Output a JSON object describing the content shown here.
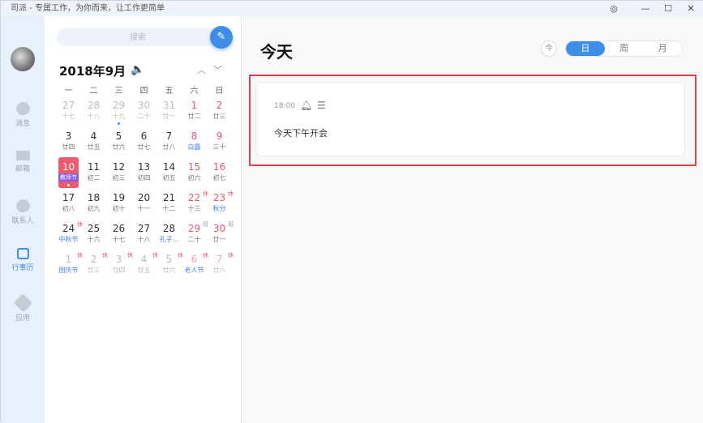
{
  "window": {
    "title": "司派 - 专属工作，为你而来，让工作更简单",
    "settings_icon": "◎",
    "min": "—",
    "max": "☐",
    "close": "✕"
  },
  "sidebar": {
    "items": [
      {
        "label": "消息"
      },
      {
        "label": "邮箱"
      },
      {
        "label": "联系人"
      },
      {
        "label": "行事历",
        "active": true
      },
      {
        "label": "应用"
      }
    ]
  },
  "calendar": {
    "search_placeholder": "搜索",
    "edit_icon": "✎",
    "month": "2018年9月",
    "speaker_icon": "🔈",
    "prev": "︿",
    "next": "﹀",
    "weekdays": [
      "一",
      "二",
      "三",
      "四",
      "五",
      "六",
      "日"
    ],
    "cells": [
      {
        "n": "27",
        "l": "十七",
        "o": 1
      },
      {
        "n": "28",
        "l": "十八",
        "o": 1
      },
      {
        "n": "29",
        "l": "十九",
        "o": 1,
        "dot": 1
      },
      {
        "n": "30",
        "l": "二十",
        "o": 1
      },
      {
        "n": "31",
        "l": "廿一",
        "o": 1
      },
      {
        "n": "1",
        "l": "廿二",
        "r": 1
      },
      {
        "n": "2",
        "l": "廿三",
        "r": 1
      },
      {
        "n": "3",
        "l": "廿四"
      },
      {
        "n": "4",
        "l": "廿五"
      },
      {
        "n": "5",
        "l": "廿六"
      },
      {
        "n": "6",
        "l": "廿七"
      },
      {
        "n": "7",
        "l": "廿八"
      },
      {
        "n": "8",
        "l": "白露",
        "r": 1,
        "f": 1
      },
      {
        "n": "9",
        "l": "三十",
        "r": 1
      },
      {
        "n": "10",
        "l": "教师节",
        "today": 1,
        "dot": 1
      },
      {
        "n": "11",
        "l": "初二"
      },
      {
        "n": "12",
        "l": "初三"
      },
      {
        "n": "13",
        "l": "初四"
      },
      {
        "n": "14",
        "l": "初五"
      },
      {
        "n": "15",
        "l": "初六",
        "r": 1
      },
      {
        "n": "16",
        "l": "初七",
        "r": 1
      },
      {
        "n": "17",
        "l": "初八"
      },
      {
        "n": "18",
        "l": "初九"
      },
      {
        "n": "19",
        "l": "初十"
      },
      {
        "n": "20",
        "l": "十一"
      },
      {
        "n": "21",
        "l": "十二"
      },
      {
        "n": "22",
        "l": "十三",
        "r": 1,
        "b": "休"
      },
      {
        "n": "23",
        "l": "秋分",
        "r": 1,
        "f": 1,
        "b": "休"
      },
      {
        "n": "24",
        "l": "中秋节",
        "f": 1,
        "b": "休"
      },
      {
        "n": "25",
        "l": "十六"
      },
      {
        "n": "26",
        "l": "十七"
      },
      {
        "n": "27",
        "l": "十八"
      },
      {
        "n": "28",
        "l": "孔子...",
        "f": 1
      },
      {
        "n": "29",
        "l": "二十",
        "r": 1,
        "b": "班"
      },
      {
        "n": "30",
        "l": "廿一",
        "r": 1,
        "b": "班"
      },
      {
        "n": "1",
        "l": "国庆节",
        "o": 1,
        "f": 1,
        "b": "休"
      },
      {
        "n": "2",
        "l": "廿三",
        "o": 1,
        "b": "休"
      },
      {
        "n": "3",
        "l": "廿四",
        "o": 1,
        "b": "休"
      },
      {
        "n": "4",
        "l": "廿五",
        "o": 1,
        "b": "休"
      },
      {
        "n": "5",
        "l": "廿六",
        "o": 1,
        "b": "休"
      },
      {
        "n": "6",
        "l": "老人节",
        "o": 1,
        "r": 1,
        "f": 1,
        "b": "休"
      },
      {
        "n": "7",
        "l": "廿八",
        "o": 1,
        "r": 1,
        "b": "休"
      }
    ]
  },
  "main": {
    "title": "今天",
    "today_btn": "今",
    "views": [
      "日",
      "周",
      "月"
    ],
    "active_view": "日",
    "event": {
      "time": "18:00",
      "bell_icon": "🔔",
      "note_icon": "☰",
      "title": "今天下午开会"
    }
  },
  "colors": {
    "accent": "#3e8ee6",
    "holiday": "#e05a6c",
    "highlight": "#d9414e"
  }
}
